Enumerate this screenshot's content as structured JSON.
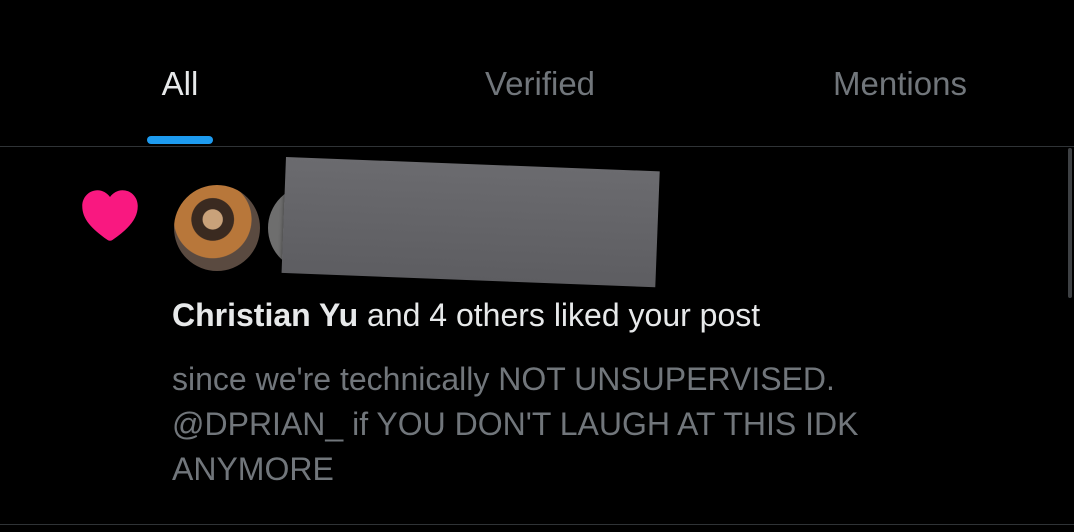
{
  "tabs": [
    {
      "label": "All",
      "active": true
    },
    {
      "label": "Verified",
      "active": false
    },
    {
      "label": "Mentions",
      "active": false
    }
  ],
  "colors": {
    "background": "#000000",
    "accent": "#1d9bf0",
    "like": "#f91880",
    "text_primary": "#e7e9ea",
    "text_secondary": "#71767b"
  },
  "notification": {
    "type_icon": "heart-icon",
    "actor_name": "Christian Yu",
    "action_text": "and 4 others liked your post",
    "post_lines": [
      "since we're technically NOT UNSUPERVISED.",
      "@DPRIAN_  if YOU DON'T LAUGH AT THIS IDK",
      "ANYMORE"
    ]
  }
}
